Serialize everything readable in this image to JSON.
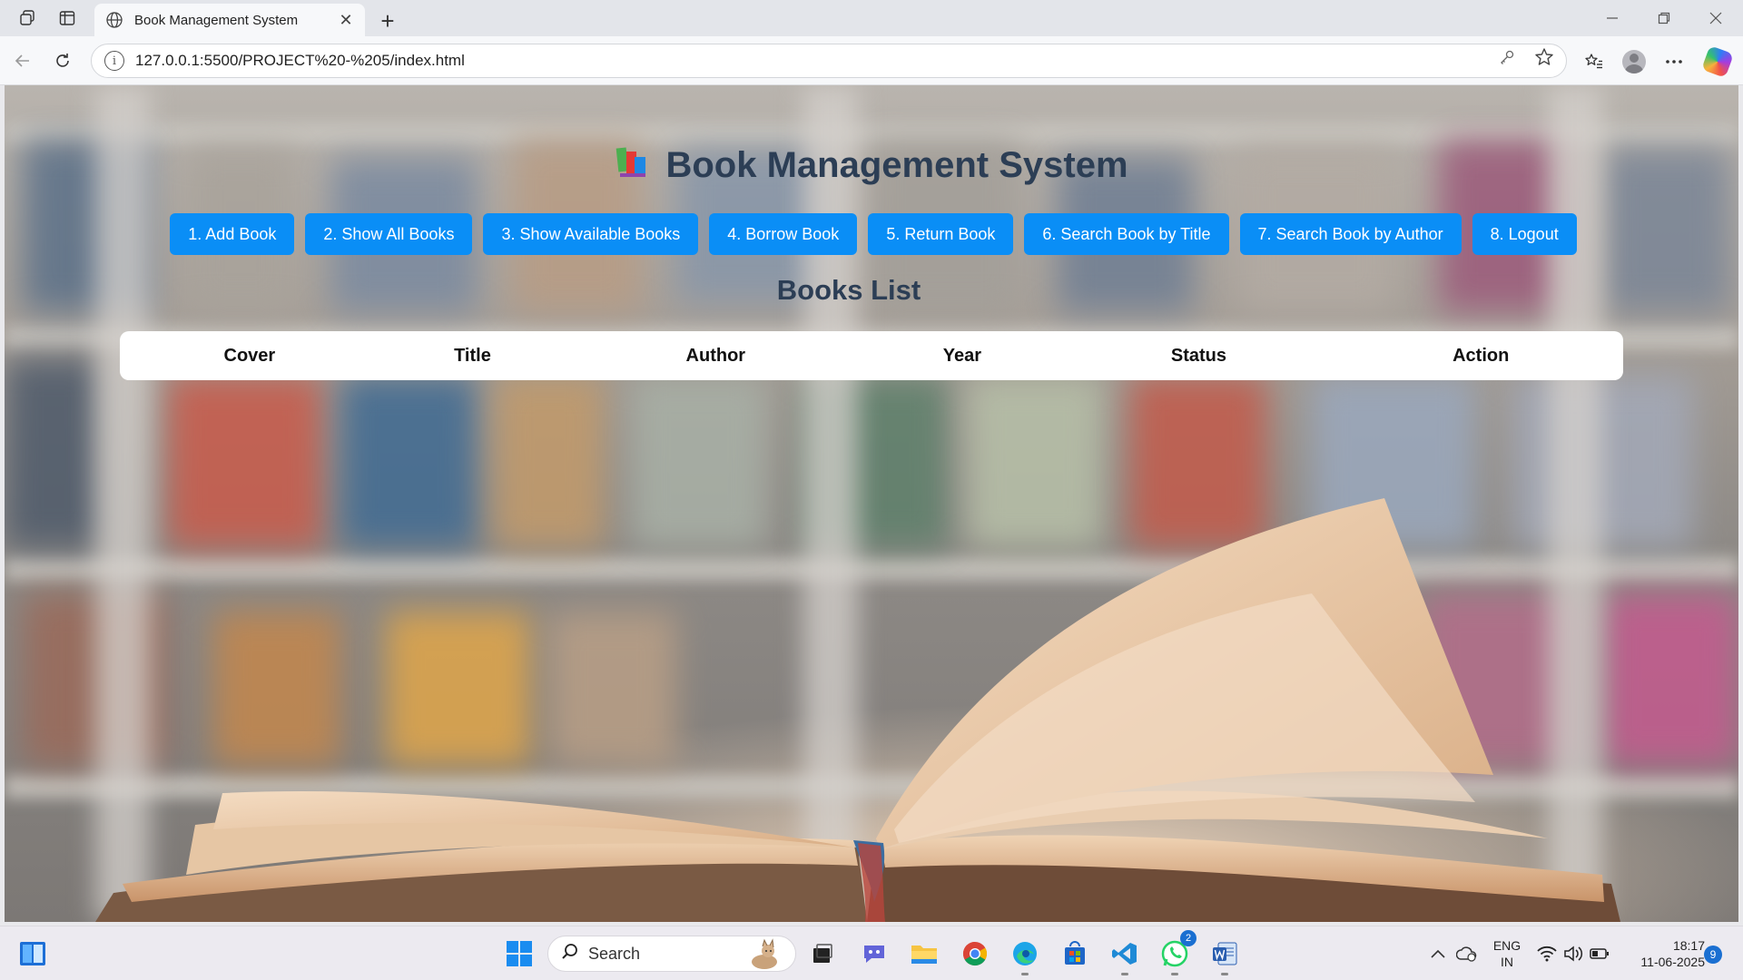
{
  "browser": {
    "tab_title": "Book Management System",
    "url": "127.0.0.1:5500/PROJECT%20-%205/index.html"
  },
  "page": {
    "title": "Book Management System",
    "title_icon": "books-icon",
    "menu": [
      "1. Add Book",
      "2. Show All Books",
      "3. Show Available Books",
      "4. Borrow Book",
      "5. Return Book",
      "6. Search Book by Title",
      "7. Search Book by Author",
      "8. Logout"
    ],
    "list_heading": "Books List",
    "table_headers": [
      "Cover",
      "Title",
      "Author",
      "Year",
      "Status",
      "Action"
    ],
    "accent_color": "#0a8ef6",
    "heading_color": "#2c3e55"
  },
  "taskbar": {
    "search_label": "Search",
    "whatsapp_badge": "2",
    "language_line1": "ENG",
    "language_line2": "IN",
    "time": "18:17",
    "date": "11-06-2025",
    "notification_count": "9"
  }
}
